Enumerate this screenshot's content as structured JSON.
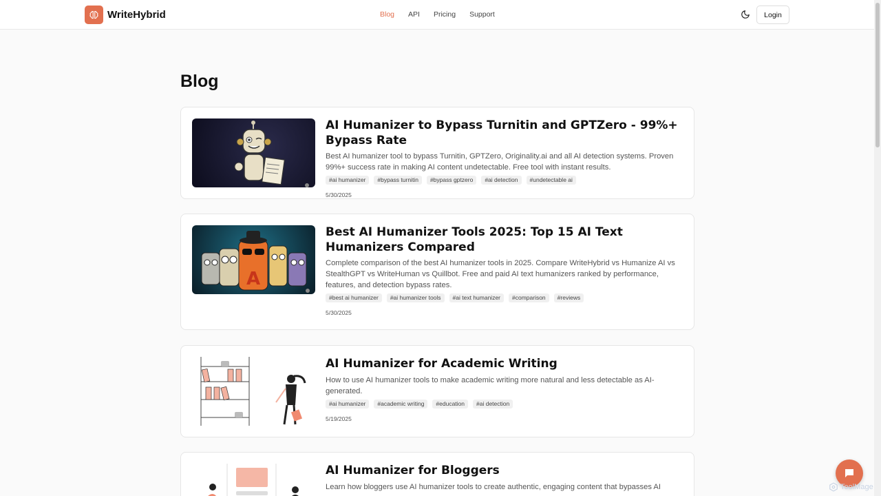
{
  "header": {
    "brand": "WriteHybrid",
    "nav": [
      {
        "label": "Blog",
        "active": true
      },
      {
        "label": "API",
        "active": false
      },
      {
        "label": "Pricing",
        "active": false
      },
      {
        "label": "Support",
        "active": false
      }
    ],
    "theme_icon": "moon-icon",
    "login_label": "Login"
  },
  "page": {
    "title": "Blog"
  },
  "posts": [
    {
      "title": "AI Humanizer to Bypass Turnitin and GPTZero - 99%+ Bypass Rate",
      "description": "Best AI humanizer tool to bypass Turnitin, GPTZero, Originality.ai and all AI detection systems. Proven 99%+ success rate in making AI content undetectable. Free tool with instant results.",
      "tags": [
        "#ai humanizer",
        "#bypass turnitin",
        "#bypass gptzero",
        "#ai detection",
        "#undetectable ai"
      ],
      "date": "5/30/2025"
    },
    {
      "title": "Best AI Humanizer Tools 2025: Top 15 AI Text Humanizers Compared",
      "description": "Complete comparison of the best AI humanizer tools in 2025. Compare WriteHybrid vs Humanize AI vs StealthGPT vs WriteHuman vs Quillbot. Free and paid AI text humanizers ranked by performance, features, and detection bypass rates.",
      "tags": [
        "#best ai humanizer",
        "#ai humanizer tools",
        "#ai text humanizer",
        "#comparison",
        "#reviews"
      ],
      "date": "5/30/2025"
    },
    {
      "title": "AI Humanizer for Academic Writing",
      "description": "How to use AI humanizer tools to make academic writing more natural and less detectable as AI-generated.",
      "tags": [
        "#ai humanizer",
        "#academic writing",
        "#education",
        "#ai detection"
      ],
      "date": "5/19/2025"
    },
    {
      "title": "AI Humanizer for Bloggers",
      "description": "Learn how bloggers use AI humanizer tools to create authentic, engaging content that bypasses AI",
      "tags": [],
      "date": ""
    }
  ],
  "chat": {
    "icon": "chat-bubble-icon"
  },
  "watermark": {
    "text": "ToolMage"
  },
  "colors": {
    "accent": "#e2704f"
  }
}
